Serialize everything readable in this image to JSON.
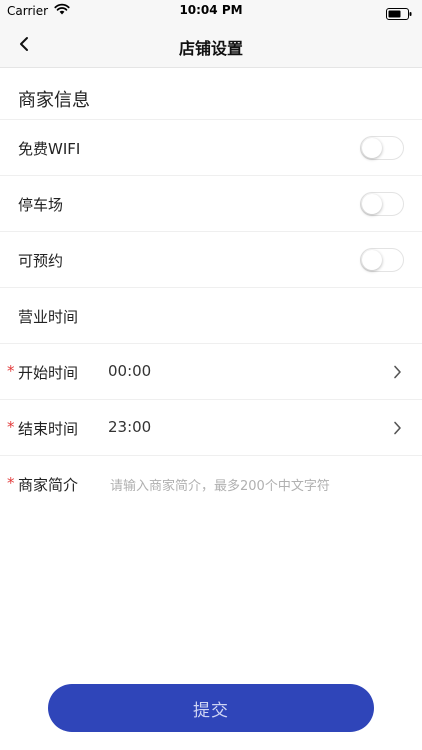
{
  "status_bar": {
    "carrier": "Carrier",
    "time": "10:04 PM"
  },
  "nav": {
    "title": "店铺设置"
  },
  "section": {
    "title": "商家信息"
  },
  "toggles": [
    {
      "label": "免费WIFI",
      "on": false
    },
    {
      "label": "停车场",
      "on": false
    },
    {
      "label": "可预约",
      "on": false
    }
  ],
  "hours": {
    "label": "营业时间",
    "start": {
      "required_mark": "*",
      "label": "开始时间",
      "value": "00:00"
    },
    "end": {
      "required_mark": "*",
      "label": "结束时间",
      "value": "23:00"
    }
  },
  "intro": {
    "required_mark": "*",
    "label": "商家简介",
    "placeholder": "请输入商家简介，最多200个中文字符"
  },
  "submit": {
    "label": "提交"
  },
  "colors": {
    "accent": "#2f45b9",
    "required": "#e23b3b"
  },
  "icons": {
    "back": "chevron-left-icon",
    "chevron": "chevron-right-icon"
  }
}
